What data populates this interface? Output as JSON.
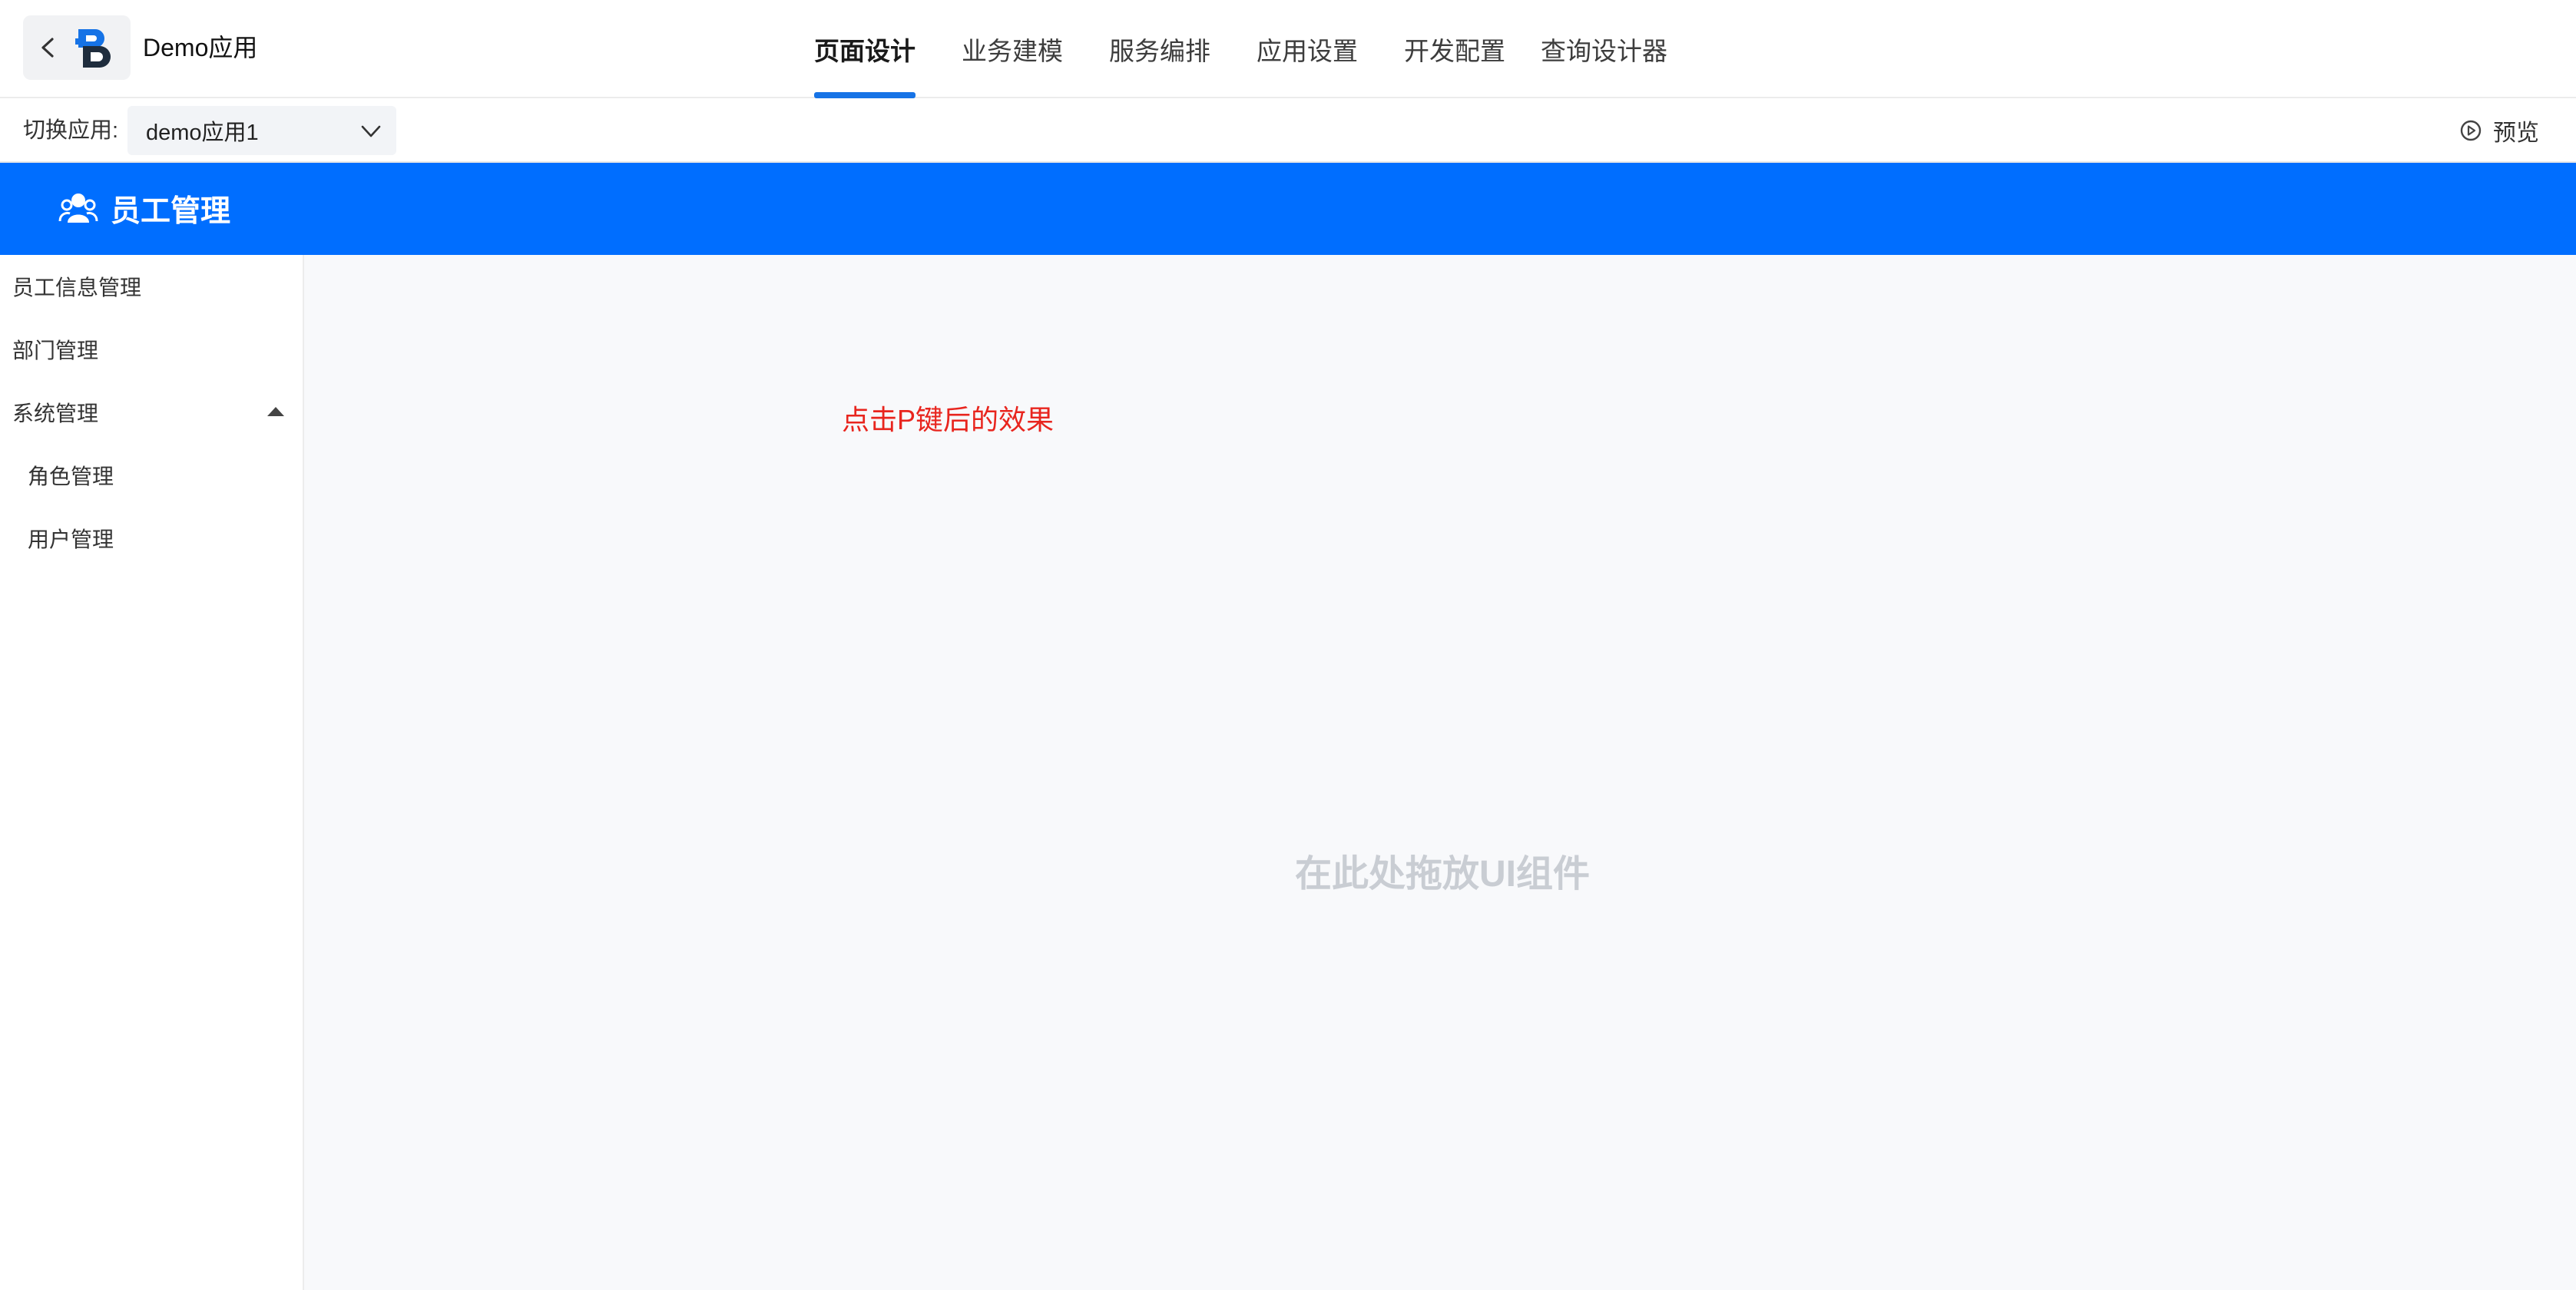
{
  "header": {
    "app_name": "Demo应用",
    "tabs": [
      {
        "label": "页面设计",
        "active": true
      },
      {
        "label": "业务建模",
        "active": false
      },
      {
        "label": "服务编排",
        "active": false
      },
      {
        "label": "应用设置",
        "active": false
      },
      {
        "label": "开发配置",
        "active": false
      },
      {
        "label": "查询设计器",
        "active": false
      }
    ],
    "accent_color": "#1673e6"
  },
  "subbar": {
    "switch_label": "切换应用:",
    "selected_app": "demo应用1",
    "preview_label": "预览"
  },
  "banner": {
    "title": "员工管理",
    "background_color": "#006eff"
  },
  "sidebar": {
    "items": [
      {
        "label": "员工信息管理"
      },
      {
        "label": "部门管理"
      },
      {
        "label": "系统管理",
        "expanded": true
      },
      {
        "label": "角色管理"
      },
      {
        "label": "用户管理"
      }
    ]
  },
  "canvas": {
    "annotation": "点击P键后的效果",
    "drop_hint": "在此处拖放UI组件"
  }
}
